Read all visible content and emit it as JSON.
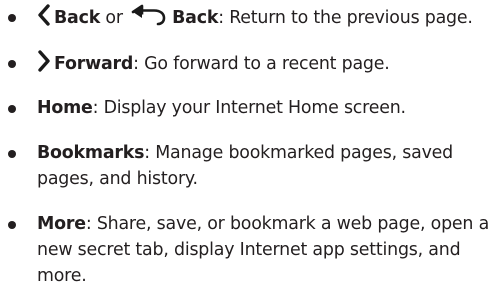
{
  "colors": {
    "text": "#231f20",
    "icon": "#1a1a1a"
  },
  "items": [
    {
      "icon": "chevron-left-icon",
      "term": "Back",
      "connector": " or ",
      "icon2": "back-arrow-icon",
      "term2": "Back",
      "description": ": Return to the previous page."
    },
    {
      "icon": "chevron-right-icon",
      "term": "Forward",
      "description": ": Go forward to a recent page."
    },
    {
      "term": "Home",
      "description": ": Display your Internet Home screen."
    },
    {
      "term": "Bookmarks",
      "description": ": Manage bookmarked pages, saved pages, and history."
    },
    {
      "term": "More",
      "description": ": Share, save, or bookmark a web page, open a new secret tab, display Internet app settings, and more."
    }
  ]
}
